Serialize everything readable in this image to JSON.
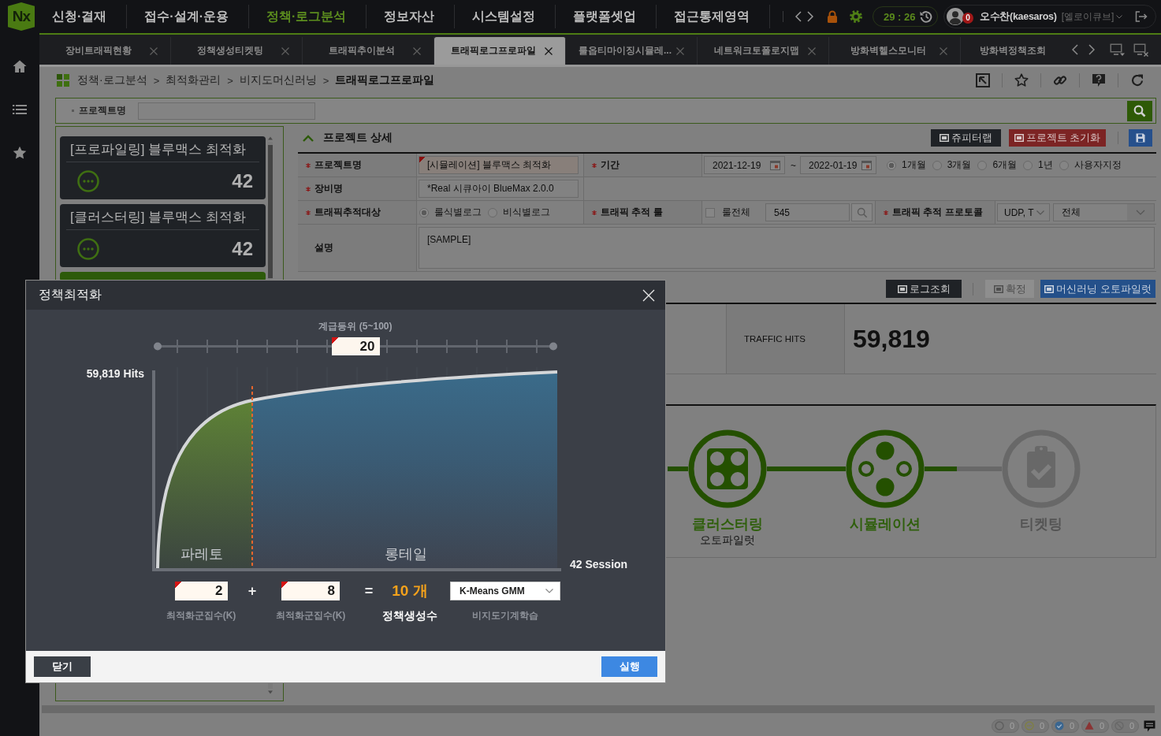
{
  "app": {
    "logo": "Nx"
  },
  "top_menu": [
    {
      "label": "신청·결재",
      "selected": false
    },
    {
      "label": "접수·설계·운용",
      "selected": false
    },
    {
      "label": "정책·로그분석",
      "selected": true
    },
    {
      "label": "정보자산",
      "selected": false
    },
    {
      "label": "시스템설정",
      "selected": false
    },
    {
      "label": "플랫폼셋업",
      "selected": false
    },
    {
      "label": "접근통제영역",
      "selected": false
    }
  ],
  "session": {
    "timer": "29 : 26",
    "alerts": "0",
    "user": "오수찬(kaesaros)",
    "org": "[엘로이큐브]"
  },
  "tabs": [
    {
      "label": "장비트래픽현황",
      "selected": false,
      "closable": true
    },
    {
      "label": "정책생성티켓팅",
      "selected": false,
      "closable": true
    },
    {
      "label": "트래픽추이분석",
      "selected": false,
      "closable": true
    },
    {
      "label": "트래픽로그프로파일",
      "selected": true,
      "closable": true
    },
    {
      "label": "룰옵티마이징시뮬레...",
      "selected": false,
      "closable": true
    },
    {
      "label": "네트워크토폴로지맵",
      "selected": false,
      "closable": true
    },
    {
      "label": "방화벽헬스모니터",
      "selected": false,
      "closable": true
    },
    {
      "label": "방화벽정책조회",
      "selected": false,
      "closable": false
    }
  ],
  "breadcrumb": {
    "separator": ">",
    "items": [
      {
        "label": "정책·로그분석",
        "current": false
      },
      {
        "label": "최적화관리",
        "current": false
      },
      {
        "label": "비지도머신러닝",
        "current": false
      },
      {
        "label": "트래픽로그프로파일",
        "current": true
      }
    ]
  },
  "search": {
    "label": "프로젝트명"
  },
  "project_cards": [
    {
      "title": "[프로파일링] 블루맥스 최적화",
      "count": "42",
      "selected": false
    },
    {
      "title": "[클러스터링] 블루맥스 최적화",
      "count": "42",
      "selected": false
    },
    {
      "selected": true
    }
  ],
  "project_detail": {
    "title": "프로젝트 상세",
    "expanded": true,
    "buttons": [
      {
        "kind": "dark",
        "label": "쥬피터랩"
      },
      {
        "kind": "danger",
        "label": "프로젝트 초기화"
      },
      {
        "kind": "save"
      }
    ]
  },
  "form": {
    "project_name": {
      "label": "프로젝트명",
      "required": true,
      "value": "[시뮬레이션] 블루맥스 최적화",
      "flagged": true
    },
    "period": {
      "label": "기간",
      "required": true,
      "from": "2021-12-19",
      "separator": "~",
      "to": "2022-01-19",
      "options": [
        {
          "label": "1개월",
          "selected": true
        },
        {
          "label": "3개월",
          "selected": false
        },
        {
          "label": "6개월",
          "selected": false
        },
        {
          "label": "1년",
          "selected": false
        },
        {
          "label": "사용자지정",
          "selected": false
        }
      ]
    },
    "device": {
      "label": "장비명",
      "required": true,
      "value": "*Real 시큐아이 BlueMax 2.0.0",
      "flagged": false
    },
    "target": {
      "label": "트래픽추적대상",
      "required": true,
      "options": [
        {
          "label": "룰식별로그",
          "selected": true
        },
        {
          "label": "비식별로그",
          "selected": false
        }
      ]
    },
    "rule": {
      "label": "트래픽 추적 룰",
      "required": true,
      "all_label": "룰전체",
      "all_checked": false,
      "value": "545"
    },
    "protocol": {
      "label": "트래픽 추적 프로토콜",
      "required": true,
      "value": "UDP, T",
      "scope": "전체"
    },
    "description": {
      "label": "설명",
      "required": false,
      "value": "[SAMPLE]"
    }
  },
  "actions": [
    {
      "kind": "dark",
      "label": "로그조회",
      "disabled": false
    },
    {
      "kind": "plain",
      "label": "확정",
      "disabled": true
    },
    {
      "kind": "primary",
      "label": "머신러닝 오토파일럿",
      "disabled": false
    }
  ],
  "stats": {
    "label": "TRAFFIC HITS",
    "value": "59,819"
  },
  "pipeline": [
    {
      "kind": "cluster",
      "label": "클러스터링",
      "sublabel": "오토파일럿",
      "done": true
    },
    {
      "kind": "simulation",
      "label": "시뮬레이션",
      "done": true
    },
    {
      "kind": "ticket",
      "label": "티켓팅",
      "done": false
    }
  ],
  "status_counters": [
    {
      "kind": "idle",
      "count": "0"
    },
    {
      "kind": "running",
      "count": "0"
    },
    {
      "kind": "done",
      "count": "0"
    },
    {
      "kind": "warning",
      "count": "0"
    },
    {
      "kind": "blocked",
      "count": "0"
    }
  ],
  "dialog": {
    "title": "정책최적화",
    "slider": {
      "label": "계급등위 (5~100)",
      "value": "20",
      "level": 0.5,
      "flagged": true
    },
    "chart": {
      "y_label": "59,819 Hits",
      "x_label": "42 Session",
      "pareto_label": "파레토",
      "longtail_label": "롱테일"
    },
    "formula": {
      "first": {
        "value": "2",
        "caption": "최적화군집수(K)",
        "flagged": true
      },
      "plus": "+",
      "second": {
        "value": "8",
        "caption": "최적화군집수(K)",
        "flagged": true
      },
      "equals": "=",
      "result": {
        "value": "10 개",
        "caption": "정책생성수"
      },
      "method": {
        "value": "K-Means GMM",
        "caption": "비지도기계학습"
      }
    },
    "buttons": {
      "close": "닫기",
      "run": "실행"
    }
  }
}
